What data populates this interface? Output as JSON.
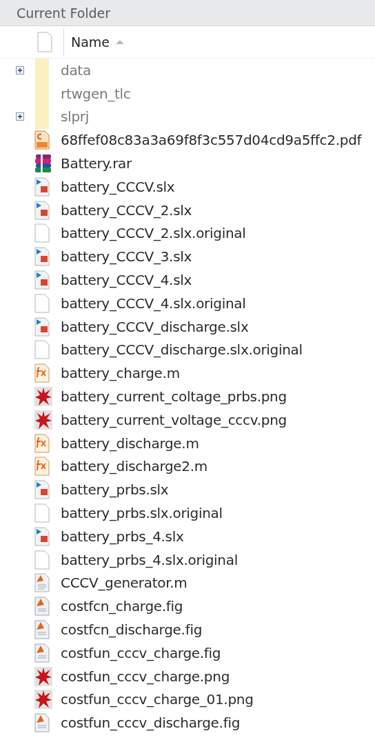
{
  "panel": {
    "title": "Current Folder"
  },
  "columns": [
    {
      "label": "Name",
      "sorted_ascending": true
    }
  ],
  "files": [
    {
      "name": "data",
      "kind": "folder",
      "expandable": true
    },
    {
      "name": "rtwgen_tlc",
      "kind": "folder",
      "expandable": false
    },
    {
      "name": "slprj",
      "kind": "folder",
      "expandable": true
    },
    {
      "name": "68ffef08c83a3a69f8f3c557d04cd9a5ffc2.pdf",
      "kind": "pdf"
    },
    {
      "name": "Battery.rar",
      "kind": "rar"
    },
    {
      "name": "battery_CCCV.slx",
      "kind": "slx"
    },
    {
      "name": "battery_CCCV_2.slx",
      "kind": "slx"
    },
    {
      "name": "battery_CCCV_2.slx.original",
      "kind": "file"
    },
    {
      "name": "battery_CCCV_3.slx",
      "kind": "slx"
    },
    {
      "name": "battery_CCCV_4.slx",
      "kind": "slx"
    },
    {
      "name": "battery_CCCV_4.slx.original",
      "kind": "file"
    },
    {
      "name": "battery_CCCV_discharge.slx",
      "kind": "slx"
    },
    {
      "name": "battery_CCCV_discharge.slx.original",
      "kind": "file"
    },
    {
      "name": "battery_charge.m",
      "kind": "function"
    },
    {
      "name": "battery_current_coltage_prbs.png",
      "kind": "image"
    },
    {
      "name": "battery_current_voltage_cccv.png",
      "kind": "image"
    },
    {
      "name": "battery_discharge.m",
      "kind": "function"
    },
    {
      "name": "battery_discharge2.m",
      "kind": "function"
    },
    {
      "name": "battery_prbs.slx",
      "kind": "slx"
    },
    {
      "name": "battery_prbs.slx.original",
      "kind": "file"
    },
    {
      "name": "battery_prbs_4.slx",
      "kind": "slx"
    },
    {
      "name": "battery_prbs_4.slx.original",
      "kind": "file"
    },
    {
      "name": "CCCV_generator.m",
      "kind": "script"
    },
    {
      "name": "costfcn_charge.fig",
      "kind": "fig"
    },
    {
      "name": "costfcn_discharge.fig",
      "kind": "fig"
    },
    {
      "name": "costfun_cccv_charge.fig",
      "kind": "fig"
    },
    {
      "name": "costfun_cccv_charge.png",
      "kind": "image"
    },
    {
      "name": "costfun_cccv_charge_01.png",
      "kind": "image"
    },
    {
      "name": "costfun_cccv_discharge.fig",
      "kind": "fig"
    }
  ]
}
